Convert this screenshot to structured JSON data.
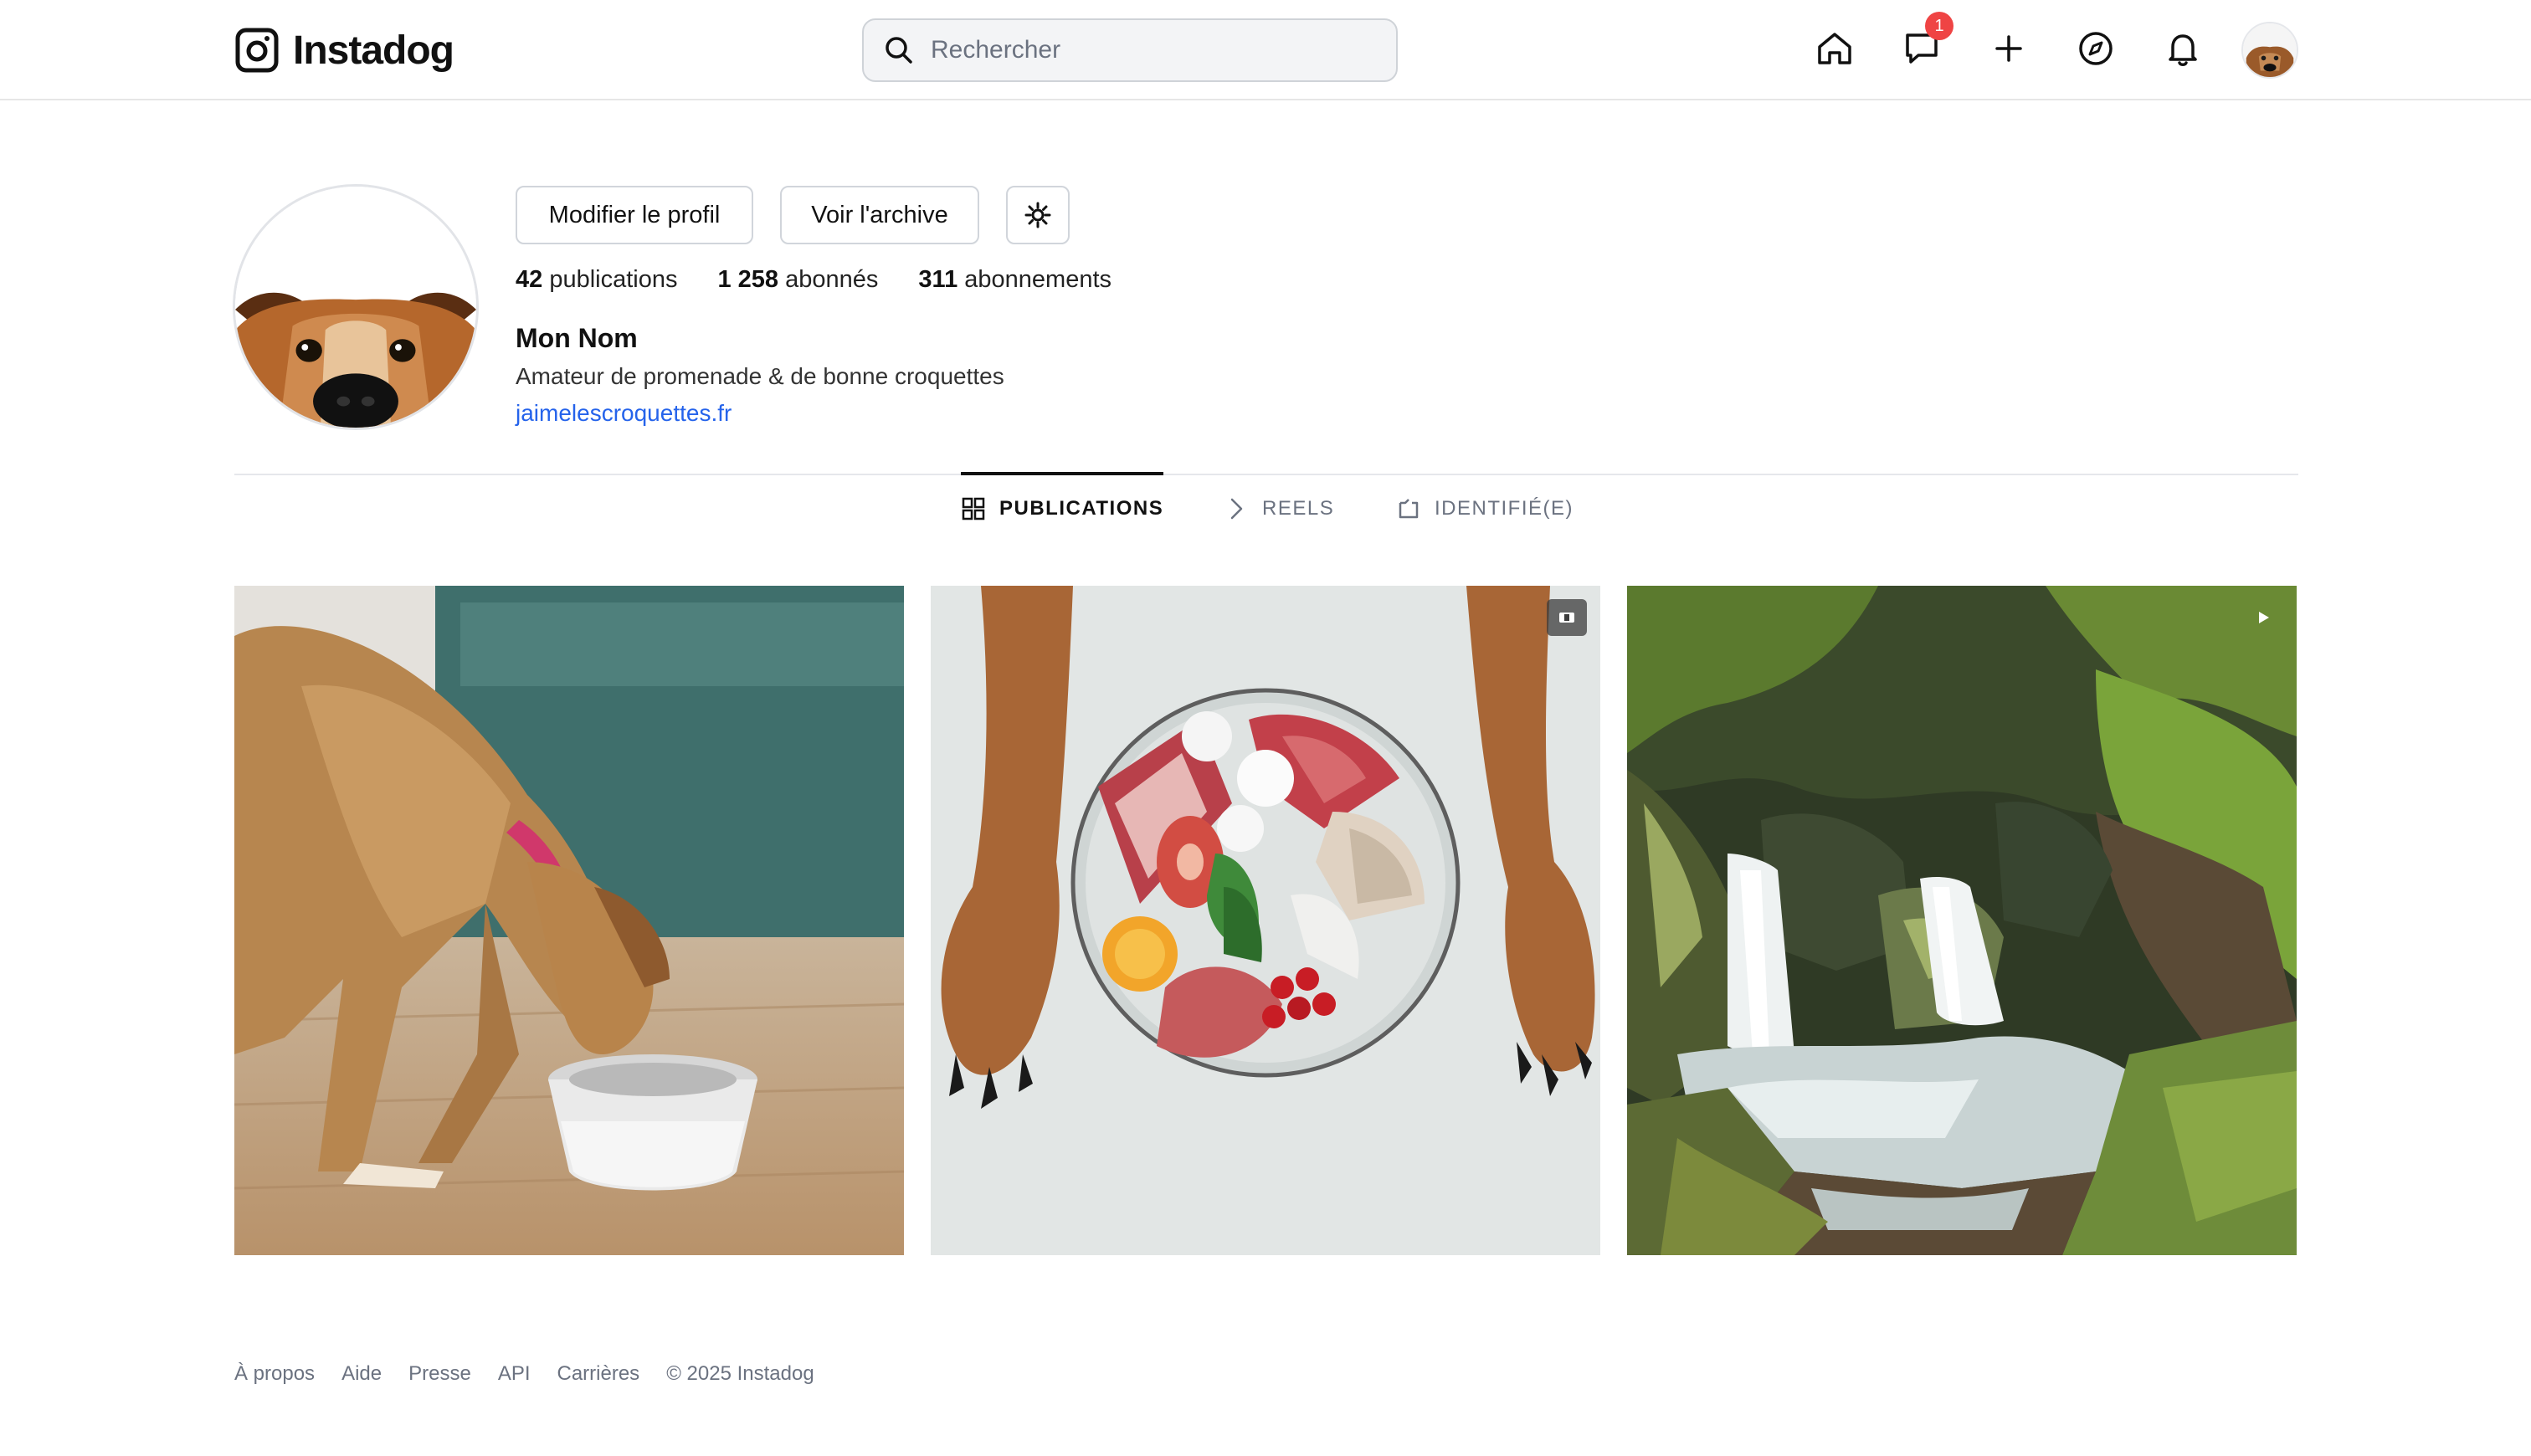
{
  "app": {
    "name": "Instadog"
  },
  "header": {
    "search": {
      "placeholder": "Rechercher",
      "value": ""
    },
    "nav": [
      {
        "icon": "home-icon"
      },
      {
        "icon": "messages-icon",
        "badge": "1"
      },
      {
        "icon": "plus-icon"
      },
      {
        "icon": "explore-compass-icon"
      },
      {
        "icon": "bell-icon"
      }
    ]
  },
  "profile": {
    "edit_button": "Modifier le profil",
    "archive_button": "Voir l'archive",
    "stats": {
      "posts_count": "42",
      "posts_label": "publications",
      "followers_count": "1 258",
      "followers_label": "abonnés",
      "following_count": "311",
      "following_label": "abonnements"
    },
    "name": "Mon Nom",
    "bio": "Amateur de promenade & de bonne croquettes",
    "link": "jaimelescroquettes.fr"
  },
  "tabs": [
    {
      "label": "PUBLICATIONS",
      "active": true
    },
    {
      "label": "REELS",
      "active": false
    },
    {
      "label": "IDENTIFIÉ(E)",
      "active": false
    }
  ],
  "posts": [
    {
      "subject": "dog eating from bowl",
      "badge": ""
    },
    {
      "subject": "raw food plate between dog paws",
      "badge": "carousel-icon"
    },
    {
      "subject": "waterfall in forest",
      "badge": "video-icon"
    }
  ],
  "footer": {
    "links": [
      "À propos",
      "Aide",
      "Presse",
      "API",
      "Carrières"
    ],
    "copyright": "© 2025 Instadog"
  },
  "colors": {
    "accent_link": "#2563eb",
    "badge_red": "#ef4444",
    "text": "#111111",
    "muted": "#6b7280"
  }
}
